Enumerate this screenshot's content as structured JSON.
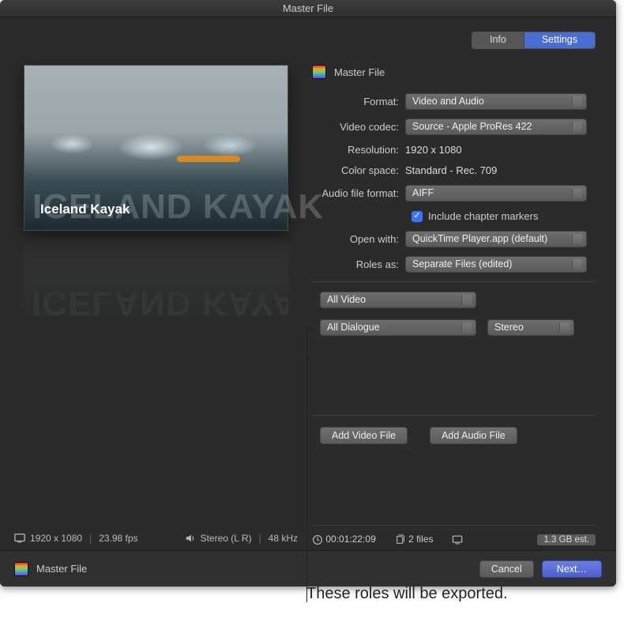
{
  "window": {
    "title": "Master File"
  },
  "tabs": {
    "info": "Info",
    "settings": "Settings",
    "active": "settings"
  },
  "section": {
    "title": "Master File"
  },
  "preview": {
    "overlay_small": "Iceland Kayak",
    "overlay_ghost": "ICELAND KAYAK"
  },
  "left_status": {
    "resolution": "1920 x 1080",
    "fps": "23.98 fps",
    "audio_channels": "Stereo (L R)",
    "audio_rate": "48 kHz"
  },
  "form": {
    "format_label": "Format:",
    "format_value": "Video and Audio",
    "codec_label": "Video codec:",
    "codec_value": "Source - Apple ProRes 422",
    "resolution_label": "Resolution:",
    "resolution_value": "1920 x 1080",
    "colorspace_label": "Color space:",
    "colorspace_value": "Standard - Rec. 709",
    "audiofmt_label": "Audio file format:",
    "audiofmt_value": "AIFF",
    "chapter_label": "Include chapter markers",
    "openwith_label": "Open with:",
    "openwith_value": "QuickTime Player.app (default)",
    "rolesas_label": "Roles as:",
    "rolesas_value": "Separate Files (edited)"
  },
  "roles": {
    "video_role": "All Video",
    "dialogue_role": "All Dialogue",
    "dialogue_mix": "Stereo"
  },
  "add": {
    "video": "Add Video File",
    "audio": "Add Audio File"
  },
  "status": {
    "duration": "00:01:22:09",
    "files": "2 files",
    "size_est": "1.3 GB est."
  },
  "footer": {
    "title": "Master File",
    "cancel": "Cancel",
    "next": "Next…"
  },
  "callout": "These roles will be exported."
}
